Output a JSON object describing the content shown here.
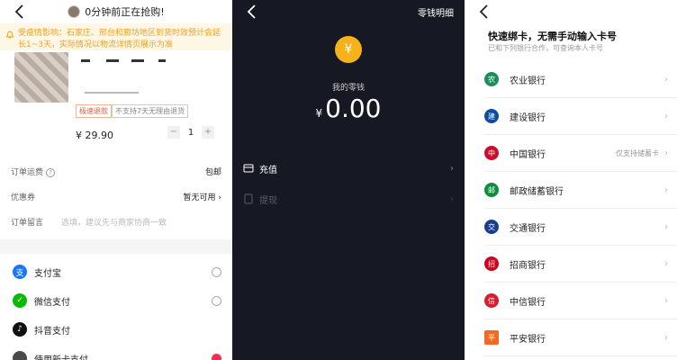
{
  "order": {
    "title": "0分钟前正在抢购!",
    "notice": "受疫情影响：石家庄、邢台和廊坊地区到货时效预计会延长1~3天，实际情况以物流详情页展示为准",
    "tags": [
      "极速退款",
      "不支持7天无理由退货"
    ],
    "price": "¥ 29.90",
    "quantity": "1",
    "minus_label": "−",
    "plus_label": "+",
    "shipping_label": "订单运费",
    "shipping_value": "包邮",
    "coupon_label": "优惠券",
    "coupon_value": "暂无可用 ›",
    "message_label": "订单留言",
    "message_placeholder": "选填，建议先与商家协商一致",
    "payments": [
      "支付宝",
      "微信支付",
      "抖音支付",
      "使用新卡支付"
    ]
  },
  "wallet": {
    "detail_link": "零钱明细",
    "coin_symbol": "¥",
    "label": "我的零钱",
    "currency": "¥",
    "amount": "0.00",
    "recharge": "充值",
    "withdraw": "提现"
  },
  "bind": {
    "heading": "快速绑卡，无需手动输入卡号",
    "subheading": "已和下列银行合作，可查询本人卡号",
    "banks": [
      {
        "name": "农业银行",
        "note": ""
      },
      {
        "name": "建设银行",
        "note": ""
      },
      {
        "name": "中国银行",
        "note": "仅支持储蓄卡"
      },
      {
        "name": "邮政储蓄银行",
        "note": ""
      },
      {
        "name": "交通银行",
        "note": ""
      },
      {
        "name": "招商银行",
        "note": ""
      },
      {
        "name": "中信银行",
        "note": ""
      },
      {
        "name": "平安银行",
        "note": ""
      }
    ]
  },
  "colors": {
    "accent": "#fe2c55",
    "wallet_bg": "#161823",
    "coin": "#f5b21a"
  }
}
